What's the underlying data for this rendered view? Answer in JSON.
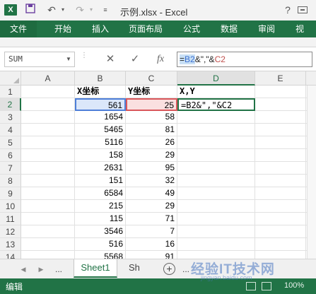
{
  "titlebar": {
    "app_badge": "X",
    "title": "示例.xlsx - Excel",
    "help": "?"
  },
  "ribbon": {
    "tabs": [
      "文件",
      "开始",
      "插入",
      "页面布局",
      "公式",
      "数据",
      "审阅",
      "视"
    ]
  },
  "formula_bar": {
    "name_box": "SUM",
    "cancel": "✕",
    "confirm": "✓",
    "fx": "fx",
    "formula_parts": [
      "=",
      "B2",
      "&\",\"&",
      "C2"
    ]
  },
  "grid": {
    "columns": [
      "A",
      "B",
      "C",
      "D",
      "E"
    ],
    "row_numbers": [
      "1",
      "2",
      "3",
      "4",
      "5",
      "6",
      "7",
      "8",
      "9",
      "10",
      "11",
      "12",
      "13",
      "14"
    ],
    "header_b": "X坐标",
    "header_c": "Y坐标",
    "header_d": "X,Y",
    "editing_text": "=B2&\",\"&C2",
    "b_values": [
      "561",
      "1654",
      "5465",
      "5116",
      "158",
      "2631",
      "151",
      "6584",
      "215",
      "115",
      "3546",
      "516",
      "5568"
    ],
    "c_values": [
      "25",
      "58",
      "81",
      "26",
      "29",
      "95",
      "32",
      "49",
      "29",
      "71",
      "7",
      "16",
      "91"
    ]
  },
  "sheets": {
    "nav_prev": "◀",
    "nav_next": "▶",
    "ellipsis": "...",
    "tab1": "Sheet1",
    "tab2": "Sh",
    "add": "+"
  },
  "status": {
    "mode": "编辑",
    "zoom": "100%"
  },
  "watermark": {
    "line1": "经验IT技术网",
    "line2": "jingyan.baidu.com"
  },
  "colors": {
    "excel_green": "#217346",
    "ref_blue": "#4e7fd8",
    "ref_red": "#d9575b"
  }
}
